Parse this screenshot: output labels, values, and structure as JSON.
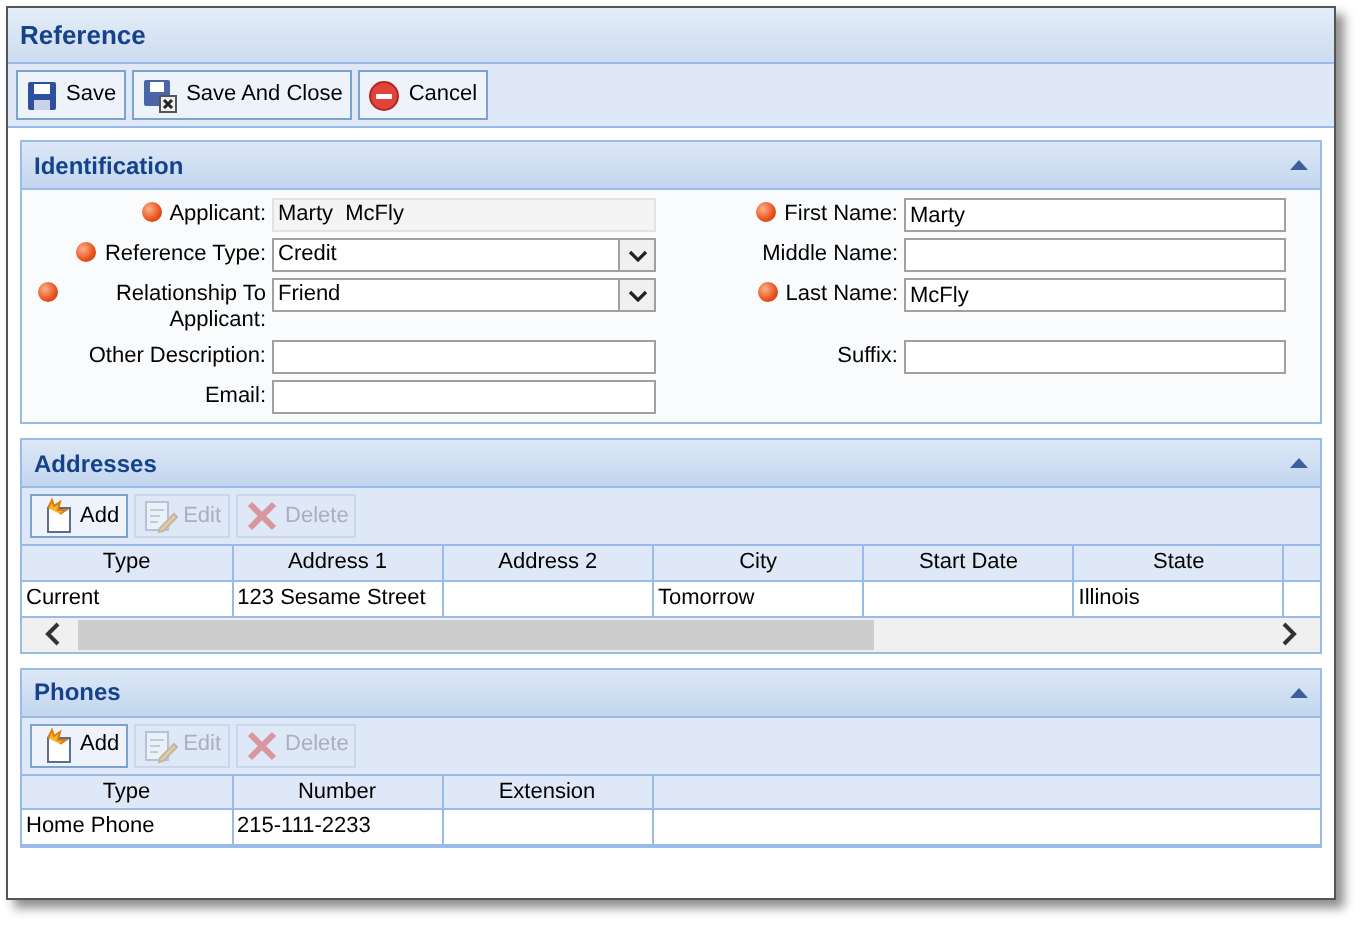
{
  "window": {
    "title": "Reference"
  },
  "toolbar": [
    {
      "label": "Save",
      "kind": "save",
      "disabled": false
    },
    {
      "label": "Save And Close",
      "kind": "save_close",
      "disabled": false
    },
    {
      "label": "Cancel",
      "kind": "cancel",
      "disabled": false
    }
  ],
  "identification": {
    "title": "Identification",
    "expanded": true,
    "rows": [
      {
        "left": {
          "label": "Applicant:",
          "required": true,
          "kind": "readonly",
          "value": "Marty  McFly"
        },
        "right": {
          "label": "First Name:",
          "required": true,
          "kind": "text",
          "value": "Marty"
        }
      },
      {
        "left": {
          "label": "Reference Type:",
          "required": true,
          "kind": "select",
          "value": "Credit"
        },
        "right": {
          "label": "Middle Name:",
          "required": false,
          "kind": "text"
        }
      },
      {
        "left": {
          "label": "Relationship To Applicant:",
          "required": true,
          "kind": "select",
          "value": "Friend"
        },
        "right": {
          "label": "Last Name:",
          "required": true,
          "kind": "text",
          "value": "McFly"
        }
      },
      {
        "left": {
          "label": "Other Description:",
          "required": false,
          "kind": "text"
        },
        "right": {
          "label": "Suffix:",
          "required": false,
          "kind": "text"
        }
      },
      {
        "left": {
          "label": "Email:",
          "required": false,
          "kind": "text"
        }
      }
    ]
  },
  "addresses": {
    "title": "Addresses",
    "expanded": true,
    "actions": [
      {
        "label": "Add",
        "kind": "add",
        "disabled": false
      },
      {
        "label": "Edit",
        "kind": "edit",
        "disabled": true
      },
      {
        "label": "Delete",
        "kind": "delete",
        "disabled": true
      }
    ],
    "columns": [
      "Type",
      "Address 1",
      "Address 2",
      "City",
      "Start Date",
      "State"
    ],
    "rows": [
      [
        "Current",
        "123 Sesame Street",
        "",
        "Tomorrow",
        "",
        "Illinois"
      ]
    ],
    "scrollbar": true
  },
  "phones": {
    "title": "Phones",
    "expanded": true,
    "actions": [
      {
        "label": "Add",
        "kind": "add",
        "disabled": false
      },
      {
        "label": "Edit",
        "kind": "edit",
        "disabled": true
      },
      {
        "label": "Delete",
        "kind": "delete",
        "disabled": true
      }
    ],
    "columns": [
      "Type",
      "Number",
      "Extension"
    ],
    "rows": [
      [
        "Home Phone",
        "215-111-2233",
        ""
      ]
    ],
    "scrollbar": false
  }
}
